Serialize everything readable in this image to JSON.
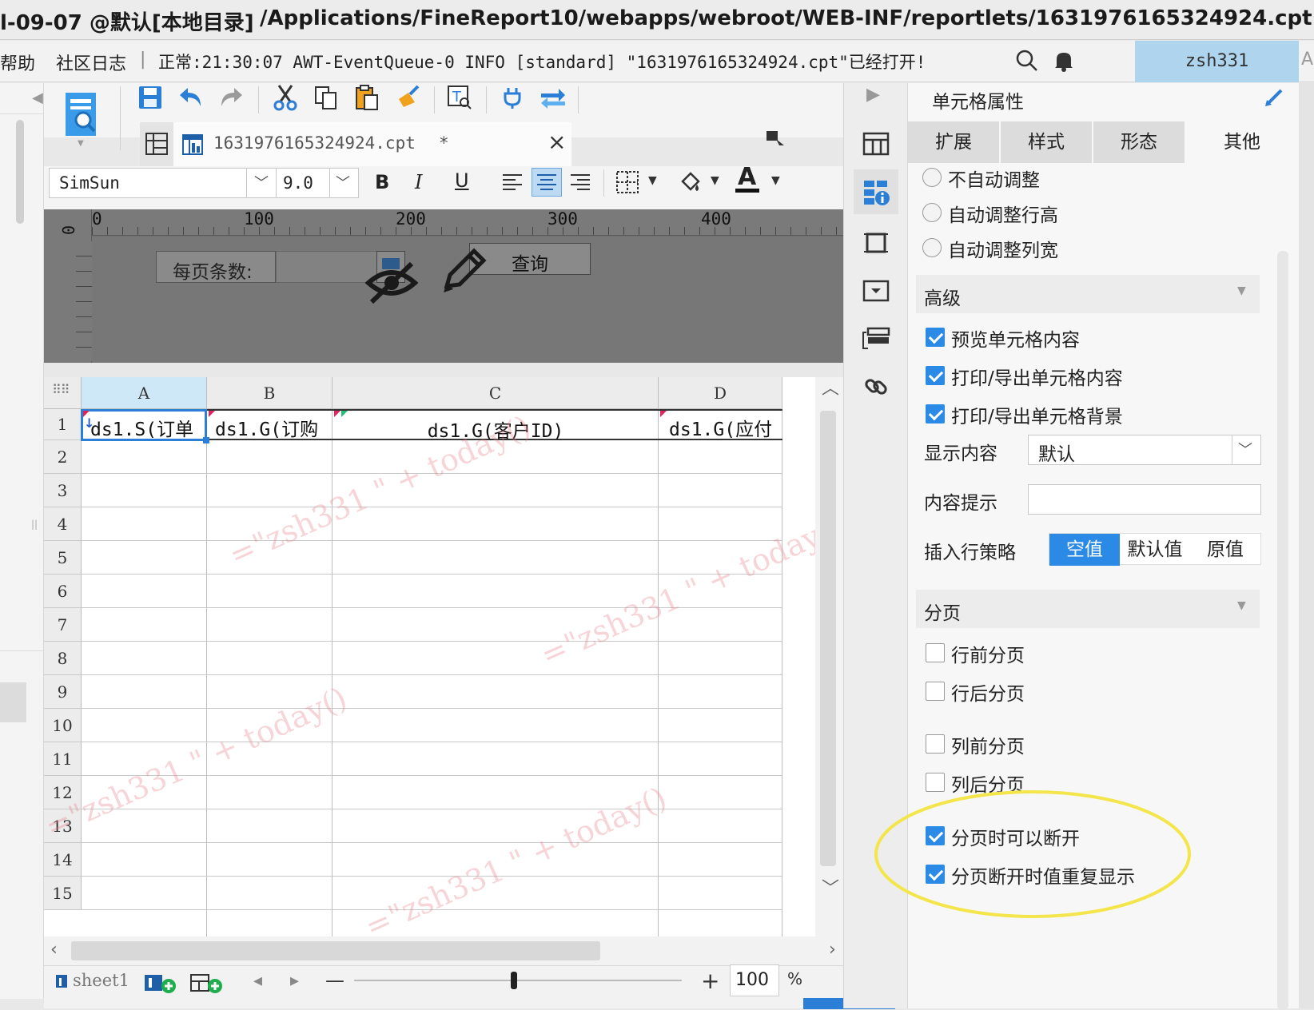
{
  "window": {
    "title_left": "l-09-07 @默认[本地目录]",
    "title_path": "/Applications/FineReport10/webapps/webroot/WEB-INF/reportlets/1631976165324924.cpt"
  },
  "menubar": {
    "help_label": "帮助",
    "community_label": "社区日志",
    "separator": "|",
    "log_message": "正常:21:30:07 AWT-EventQueue-0 INFO [standard] \"1631976165324924.cpt\"已经打开!",
    "user_name": "zsh331",
    "right_edge_text": "AP"
  },
  "file_tab": {
    "file_name": "1631976165324924.cpt",
    "modified_marker": "*",
    "close_glyph": "×"
  },
  "format_toolbar": {
    "font_family": "SimSun",
    "font_size": "9.0",
    "bold": "B",
    "italic": "I",
    "underline": "U",
    "font_color_glyph": "A"
  },
  "ruler": {
    "ticks": [
      "0",
      "100",
      "200",
      "300",
      "400"
    ],
    "vertical_zero": "0"
  },
  "parameter_form": {
    "per_page_label": "每页条数:",
    "query_button": "查询"
  },
  "sheet": {
    "columns": [
      "A",
      "B",
      "C",
      "D"
    ],
    "rows": [
      "1",
      "2",
      "3",
      "4",
      "5",
      "6",
      "7",
      "8",
      "9",
      "10",
      "11",
      "12",
      "13",
      "14",
      "15"
    ],
    "cells": {
      "A1": "ds1.S(订单",
      "B1": "ds1.G(订购",
      "C1": "ds1.G(客户ID)",
      "D1": "ds1.G(应付"
    },
    "watermark": "=\"zsh331 \" + today()"
  },
  "sheet_tabs": {
    "sheet_name": "sheet1",
    "zoom_minus": "—",
    "zoom_plus": "+",
    "zoom_value": "100",
    "zoom_unit": "%"
  },
  "panel": {
    "title": "单元格属性",
    "tabs": [
      "扩展",
      "样式",
      "形态",
      "其他"
    ],
    "active_tab": "其他",
    "auto_adjust": [
      {
        "label": "不自动调整",
        "selected": false
      },
      {
        "label": "自动调整行高",
        "selected": false
      },
      {
        "label": "自动调整列宽",
        "selected": false
      }
    ],
    "advanced_section": "高级",
    "advanced_options": [
      {
        "label": "预览单元格内容",
        "checked": true
      },
      {
        "label": "打印/导出单元格内容",
        "checked": true
      },
      {
        "label": "打印/导出单元格背景",
        "checked": true
      }
    ],
    "display_content_label": "显示内容",
    "display_content_value": "默认",
    "tooltip_label": "内容提示",
    "tooltip_value": "",
    "insert_strategy_label": "插入行策略",
    "insert_strategy_options": [
      "空值",
      "默认值",
      "原值"
    ],
    "insert_strategy_selected": "空值",
    "pagination_section": "分页",
    "pagination_options": [
      {
        "label": "行前分页",
        "checked": false
      },
      {
        "label": "行后分页",
        "checked": false
      },
      {
        "label": "列前分页",
        "checked": false
      },
      {
        "label": "列后分页",
        "checked": false
      },
      {
        "label": "分页时可以断开",
        "checked": true
      },
      {
        "label": "分页断开时值重复显示",
        "checked": true
      }
    ]
  },
  "colors": {
    "accent": "#2b8ae6",
    "user_bg": "#aed4ee",
    "highlight_ellipse": "#f3e54a",
    "selected_header": "#cfe8f8"
  }
}
